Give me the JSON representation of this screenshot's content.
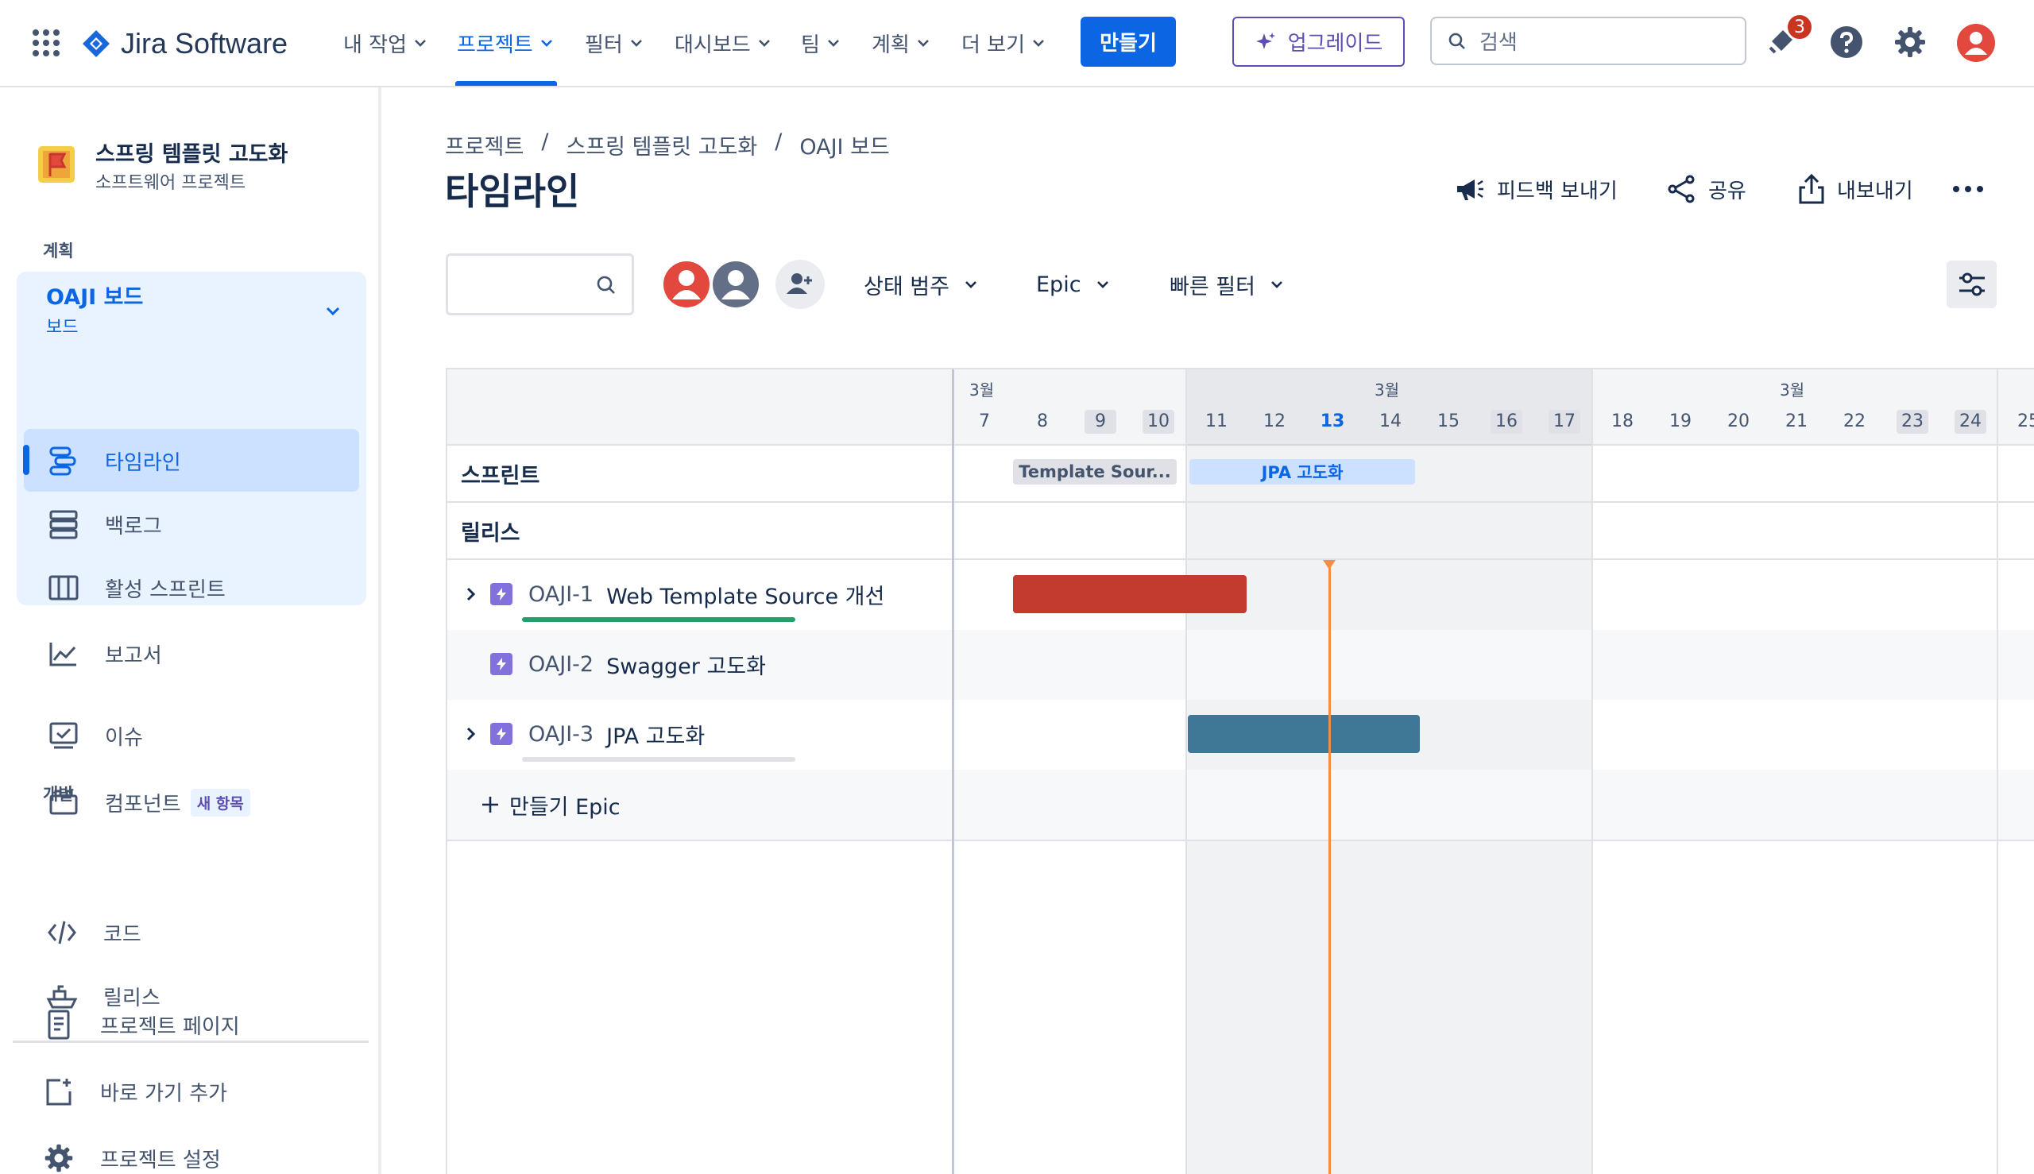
{
  "app": {
    "name": "Jira Software"
  },
  "nav": {
    "items": [
      {
        "label": "내 작업"
      },
      {
        "label": "프로젝트"
      },
      {
        "label": "필터"
      },
      {
        "label": "대시보드"
      },
      {
        "label": "팀"
      },
      {
        "label": "계획"
      },
      {
        "label": "더 보기"
      }
    ],
    "create_label": "만들기",
    "upgrade_label": "업그레이드",
    "search_placeholder": "검색",
    "notification_count": "3"
  },
  "sidebar": {
    "project_name": "스프링 템플릿 고도화",
    "project_type": "소프트웨어 프로젝트",
    "section_plan": "계획",
    "board_name": "OAJI 보드",
    "board_sub": "보드",
    "plan_items": [
      {
        "label": "타임라인"
      },
      {
        "label": "백로그"
      },
      {
        "label": "활성 스프린트"
      },
      {
        "label": "보고서"
      }
    ],
    "issues_label": "이슈",
    "components_label": "컴포넌트",
    "new_tag": "새 항목",
    "section_dev": "개발",
    "dev_items": [
      {
        "label": "코드"
      },
      {
        "label": "릴리스"
      }
    ],
    "bottom_items": [
      {
        "label": "프로젝트 페이지"
      },
      {
        "label": "바로 가기 추가"
      },
      {
        "label": "프로젝트 설정"
      }
    ]
  },
  "breadcrumbs": [
    "프로젝트",
    "스프링 템플릿 고도화",
    "OAJI 보드"
  ],
  "breadcrumb_sep": "/",
  "page_title": "타임라인",
  "header_actions": {
    "feedback": "피드백 보내기",
    "share": "공유",
    "export": "내보내기"
  },
  "filters": {
    "status": "상태 범주",
    "epic": "Epic",
    "quick": "빠른 필터"
  },
  "timeline": {
    "months": [
      "3월",
      "3월",
      "3월"
    ],
    "days": [
      {
        "d": "7",
        "type": "normal"
      },
      {
        "d": "8",
        "type": "normal"
      },
      {
        "d": "9",
        "type": "weekend"
      },
      {
        "d": "10",
        "type": "weekend"
      },
      {
        "d": "11",
        "type": "normal"
      },
      {
        "d": "12",
        "type": "normal"
      },
      {
        "d": "13",
        "type": "today"
      },
      {
        "d": "14",
        "type": "normal"
      },
      {
        "d": "15",
        "type": "normal"
      },
      {
        "d": "16",
        "type": "weekend"
      },
      {
        "d": "17",
        "type": "weekend"
      },
      {
        "d": "18",
        "type": "normal"
      },
      {
        "d": "19",
        "type": "normal"
      },
      {
        "d": "20",
        "type": "normal"
      },
      {
        "d": "21",
        "type": "normal"
      },
      {
        "d": "22",
        "type": "normal"
      },
      {
        "d": "23",
        "type": "weekend"
      },
      {
        "d": "24",
        "type": "weekend"
      },
      {
        "d": "25",
        "type": "normal"
      }
    ],
    "sprints_label": "스프린트",
    "releases_label": "릴리스",
    "sprints": [
      {
        "name": "Template Sour...",
        "color": "#dfe1e6",
        "text_color": "#44546f"
      },
      {
        "name": "JPA 고도화",
        "color": "#cce0ff",
        "text_color": "#0c66e4"
      }
    ],
    "issues": [
      {
        "key": "OAJI-1",
        "title": "Web Template Source 개선",
        "bar_color": "#c23b2e",
        "progress_color": "#22a06b",
        "start": "8",
        "end": "11"
      },
      {
        "key": "OAJI-2",
        "title": "Swagger 고도화"
      },
      {
        "key": "OAJI-3",
        "title": "JPA 고도화",
        "bar_color": "#3f7796",
        "progress_color": "#dfe1e6",
        "start": "11",
        "end": "14"
      }
    ],
    "create_epic_label": "만들기 Epic"
  }
}
